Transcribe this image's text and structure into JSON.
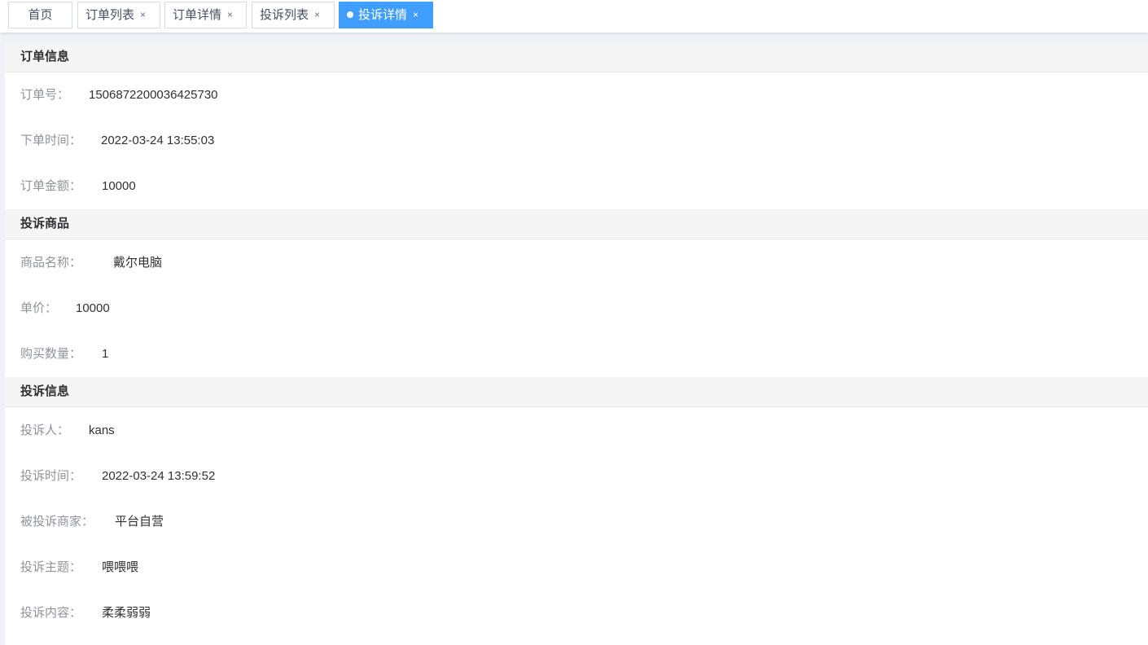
{
  "tabs": {
    "home": "首页",
    "orders": "订单列表",
    "order_detail": "订单详情",
    "complaints": "投诉列表",
    "complaint_detail": "投诉详情",
    "close_glyph": "×",
    "active_color": "#409eff"
  },
  "order_info": {
    "title": "订单信息",
    "order_no_label": "订单号：",
    "order_no": "1506872200036425730",
    "order_time_label": "下单时间：",
    "order_time": "2022-03-24 13:55:03",
    "amount_label": "订单金额：",
    "amount": "10000"
  },
  "product_info": {
    "title": "投诉商品",
    "name_label": "商品名称：",
    "name": "戴尔电脑",
    "price_label": "单价：",
    "price": "10000",
    "quantity_label": "购买数量：",
    "quantity": "1"
  },
  "complaint_info": {
    "title": "投诉信息",
    "complainant_label": "投诉人：",
    "complainant": "kans",
    "time_label": "投诉时间：",
    "time": "2022-03-24 13:59:52",
    "merchant_label": "被投诉商家：",
    "merchant": "平台自营",
    "subject_label": "投诉主题：",
    "subject": "喂喂喂",
    "content_label": "投诉内容：",
    "content": "柔柔弱弱"
  }
}
